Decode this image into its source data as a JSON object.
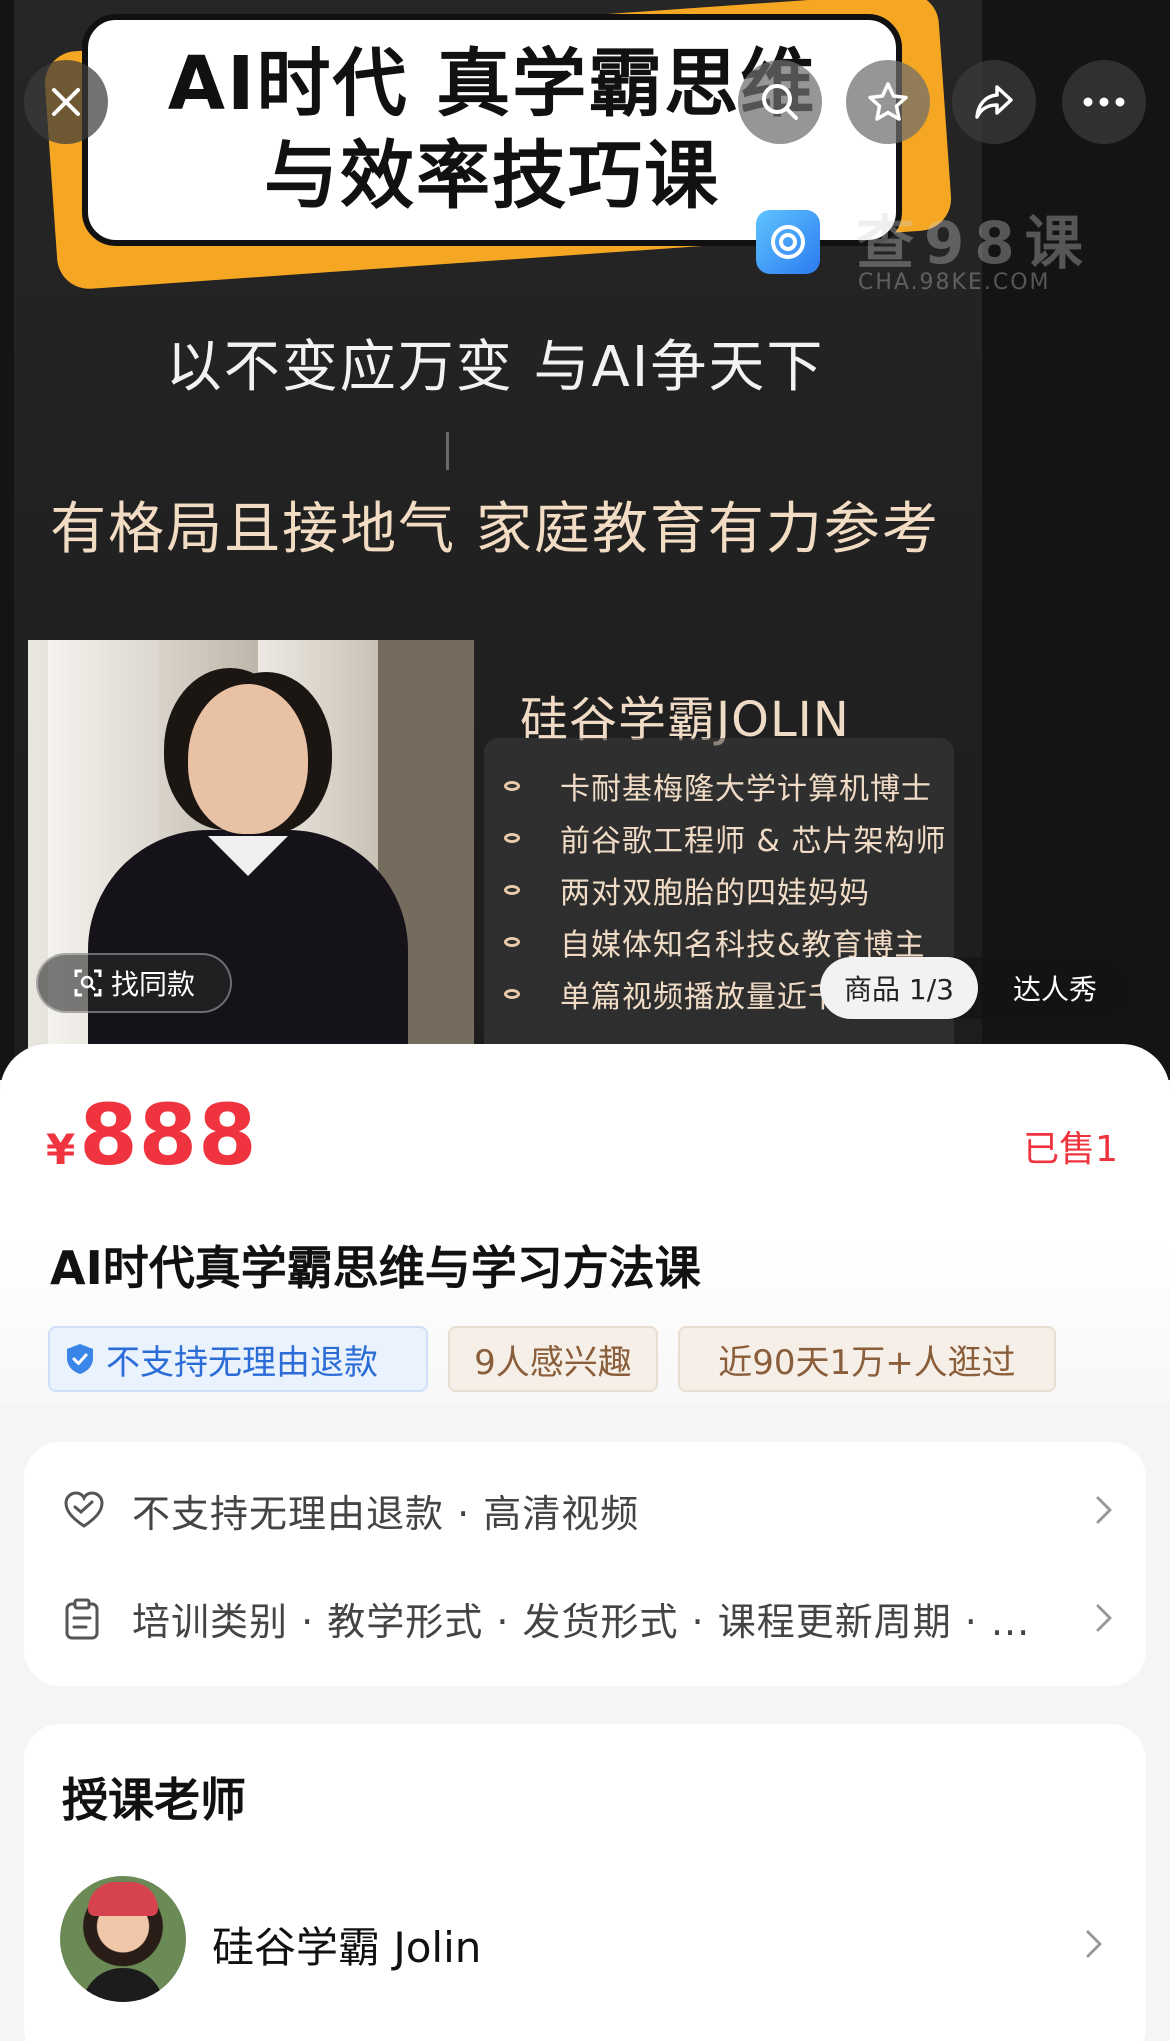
{
  "hero": {
    "title_line1": "AI时代 真学霸思维",
    "title_line2": "与效率技巧课",
    "slogan1": "以不变应万变  与AI争天下",
    "slogan2": "有格局且接地气  家庭教育有力参考",
    "profile_name": "硅谷学霸JOLIN",
    "profile_items": [
      "卡耐基梅隆大学计算机博士",
      "前谷歌工程师 & 芯片架构师",
      "两对双胞胎的四娃妈妈",
      "自媒体知名科技&教育博主",
      "单篇视频播放量近千"
    ],
    "watermark_text": "查98课",
    "watermark_sub": "CHA.98KE.COM",
    "find_same_label": "找同款",
    "switch_active_label": "商品 1/3",
    "switch_other_label": "达人秀"
  },
  "top_buttons": {
    "close": "close-icon",
    "search": "search-icon",
    "favorite": "star-icon",
    "share": "share-icon",
    "more": "more-icon"
  },
  "product": {
    "currency": "¥",
    "price": "888",
    "sold": "已售1",
    "title": "AI时代真学霸思维与学习方法课",
    "tags": {
      "refund": "不支持无理由退款",
      "interest": "9人感兴趣",
      "visits": "近90天1万+人逛过"
    }
  },
  "service": {
    "row1": "不支持无理由退款 · 高清视频",
    "row2": "培训类别 · 教学形式 · 发货形式 · 课程更新周期 · ..."
  },
  "teacher": {
    "heading": "授课老师",
    "name": "硅谷学霸 Jolin"
  },
  "colors": {
    "price_red": "#f0343f",
    "refund_blue": "#2b6cd6",
    "tag_brown": "#8a5e3a",
    "title_card_orange": "#f5a623"
  }
}
